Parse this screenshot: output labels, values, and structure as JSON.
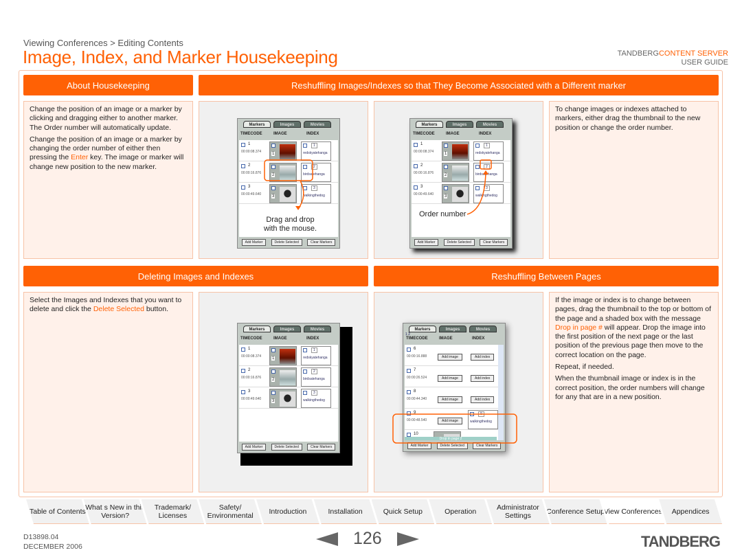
{
  "breadcrumb": "Viewing Conferences > Editing Contents",
  "title": "Image, Index, and Marker Housekeeping",
  "brand": {
    "name": "TANDBERG",
    "product": "CONTENT SERVER",
    "guide": "USER GUIDE"
  },
  "colors": {
    "accent": "#ff6105",
    "panel_text_bg": "#fff1ea",
    "panel_pic_bg": "#f0f0f0"
  },
  "sections": {
    "about": {
      "header": "About Housekeeping",
      "p1": "Change the position of an image or a marker by clicking and dragging either to another marker. The Order number will automatically update.",
      "p2a": "Change the position of an image or a marker by changing the order number of either then pressing the ",
      "p2key": "Enter",
      "p2b": " key. The image or marker will change new position to the new marker."
    },
    "reshuffle": {
      "header": "Reshuffling Images/Indexes so that They Become Associated with a Different marker",
      "text": "To change images or indexes attached to markers, either drag the thumbnail to the new position or change the order number.",
      "caption1a": "Drag and drop",
      "caption1b": "with the mouse.",
      "caption2": "Order number"
    },
    "deleting": {
      "header": "Deleting Images and Indexes",
      "ta": "Select the Images and Indexes that you want to delete and click the ",
      "link": "Delete Selected",
      "tb": " button."
    },
    "pages": {
      "header": "Reshuffling Between Pages",
      "p1a": "If the image or index is to change between pages, drag the thumbnail to the top or bottom of the page and a shaded box with the message ",
      "p1msg": "Drop in page #",
      "p1b": " will appear.  Drop the image into the first position of the next page or the last position of the previous page then move to the correct location on the page.",
      "p2": "Repeat, if needed.",
      "p3": "When the thumbnail image or index is in the correct position, the order numbers will change for any that are in a new position."
    }
  },
  "mock": {
    "tabs": [
      "Markers",
      "Images",
      "Movies"
    ],
    "columns": [
      "TIMECODE",
      "IMAGE",
      "INDEX"
    ],
    "buttons": [
      "Add Marker",
      "Delete Selected",
      "Clear Markers"
    ],
    "rows": [
      {
        "n": "1",
        "tc": "00:00:08.374",
        "order": "1",
        "index": "redskyatehanga"
      },
      {
        "n": "2",
        "tc": "00:00:16.876",
        "order": "2",
        "index": "birdsatehanga"
      },
      {
        "n": "3",
        "tc": "00:00:49.640",
        "order": "3",
        "index": "walkingthedog"
      }
    ],
    "pager": "1 2",
    "page_rows": [
      {
        "n": "6",
        "tc": "00:00:16.888"
      },
      {
        "n": "7",
        "tc": "00:00:26.524"
      },
      {
        "n": "8",
        "tc": "00:00:44.340"
      },
      {
        "n": "9",
        "tc": "00:00:48.540",
        "order": "9",
        "index": "walkingthedog"
      },
      {
        "n": "10",
        "tc": "00:00:48.560",
        "order": "10"
      }
    ],
    "add_image": "Add image",
    "add_index": "Add index",
    "drop_msg": "Drop in page 2"
  },
  "nav": [
    {
      "label": "Table of Contents"
    },
    {
      "label": "What s New in this Version?"
    },
    {
      "label": "Trademark/ Licenses"
    },
    {
      "label": "Safety/ Environmental"
    },
    {
      "label": "Introduction"
    },
    {
      "label": "Installation"
    },
    {
      "label": "Quick Setup"
    },
    {
      "label": "Operation"
    },
    {
      "label": "Administrator Settings"
    },
    {
      "label": "Conference Setup"
    },
    {
      "label": "View Conferences",
      "active": true
    },
    {
      "label": "Appendices"
    }
  ],
  "footer": {
    "doc": "D13898.04",
    "date": "DECEMBER 2006",
    "page": "126",
    "logo": "TANDBERG"
  }
}
